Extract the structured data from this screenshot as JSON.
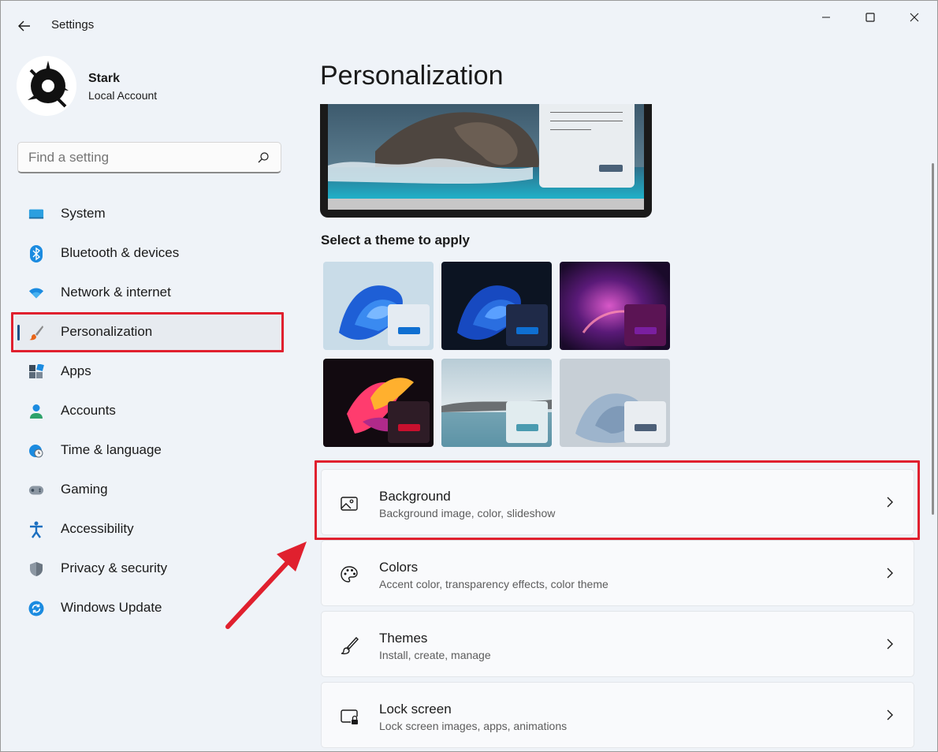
{
  "app": {
    "title": "Settings"
  },
  "profile": {
    "name": "Stark",
    "account_type": "Local Account"
  },
  "search": {
    "placeholder": "Find a setting"
  },
  "sidebar": {
    "items": [
      {
        "label": "System",
        "icon": "monitor-icon"
      },
      {
        "label": "Bluetooth & devices",
        "icon": "bluetooth-icon"
      },
      {
        "label": "Network & internet",
        "icon": "wifi-icon"
      },
      {
        "label": "Personalization",
        "icon": "paintbrush-icon",
        "active": true
      },
      {
        "label": "Apps",
        "icon": "apps-icon"
      },
      {
        "label": "Accounts",
        "icon": "person-icon"
      },
      {
        "label": "Time & language",
        "icon": "globe-clock-icon"
      },
      {
        "label": "Gaming",
        "icon": "gamepad-icon"
      },
      {
        "label": "Accessibility",
        "icon": "accessibility-icon"
      },
      {
        "label": "Privacy & security",
        "icon": "shield-icon"
      },
      {
        "label": "Windows Update",
        "icon": "update-icon"
      }
    ]
  },
  "main": {
    "title": "Personalization",
    "theme_heading": "Select a theme to apply",
    "themes": [
      {
        "name": "windows-light",
        "accent": "#0f6fd1"
      },
      {
        "name": "windows-dark",
        "accent": "#0f6fd1"
      },
      {
        "name": "glow",
        "accent": "#7a1fa0"
      },
      {
        "name": "captured-motion",
        "accent": "#c8102e"
      },
      {
        "name": "sunrise",
        "accent": "#4a9bb0"
      },
      {
        "name": "flow",
        "accent": "#4c5f78"
      }
    ],
    "settings": [
      {
        "title": "Background",
        "subtitle": "Background image, color, slideshow",
        "icon": "image-icon"
      },
      {
        "title": "Colors",
        "subtitle": "Accent color, transparency effects, color theme",
        "icon": "palette-icon"
      },
      {
        "title": "Themes",
        "subtitle": "Install, create, manage",
        "icon": "brush-icon"
      },
      {
        "title": "Lock screen",
        "subtitle": "Lock screen images, apps, animations",
        "icon": "lock-screen-icon"
      }
    ]
  },
  "colors": {
    "highlight": "#e0202e",
    "accent": "#1d4f86"
  }
}
